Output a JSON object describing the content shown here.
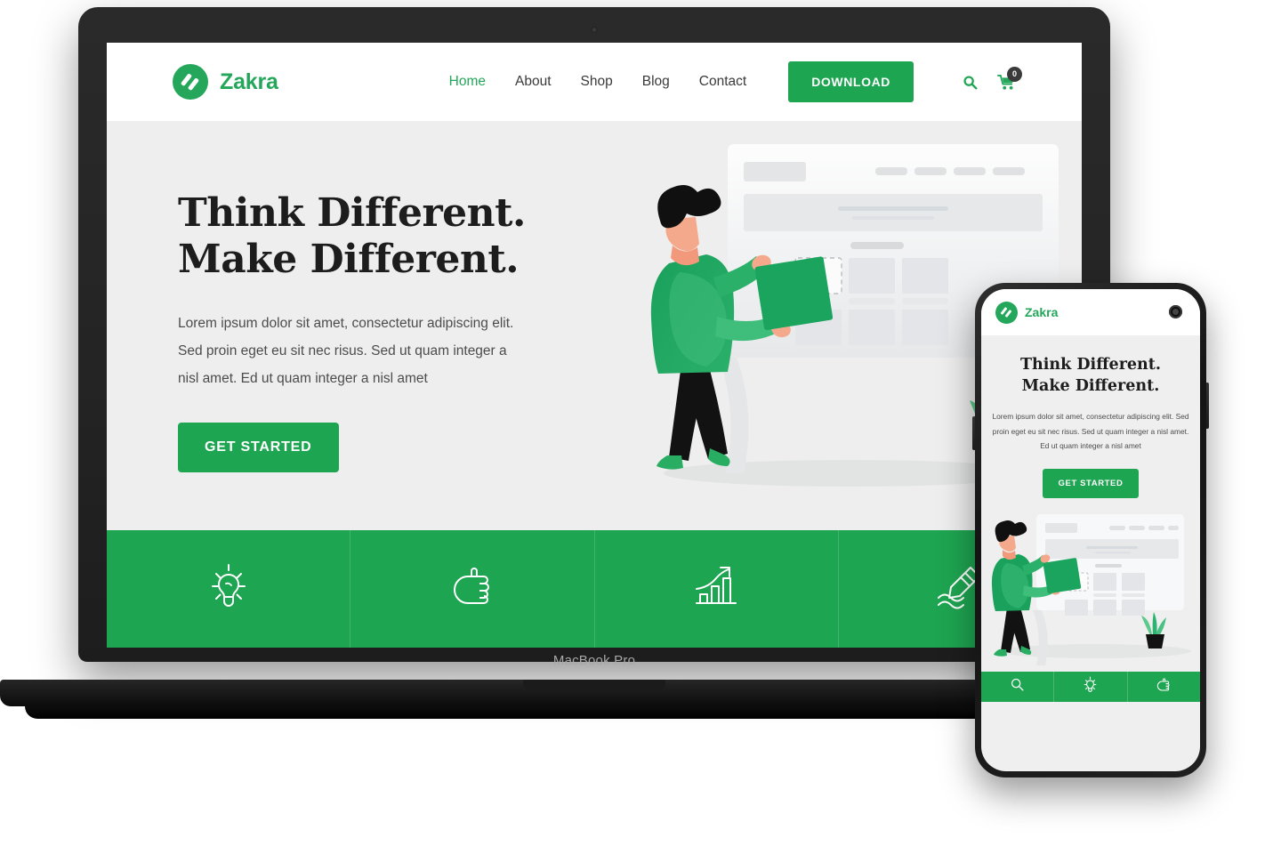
{
  "device": {
    "laptop_label": "MacBook Pro",
    "laptop_camera": "camera-dot",
    "phone_camera": "punch-hole-camera"
  },
  "brand": {
    "name": "Zakra",
    "logo_icon": "zakra-z-logo-icon",
    "accent_color": "#1ea551",
    "brand_green": "#24a75b"
  },
  "nav": {
    "links": [
      {
        "label": "Home",
        "active": true
      },
      {
        "label": "About",
        "active": false
      },
      {
        "label": "Shop",
        "active": false
      },
      {
        "label": "Blog",
        "active": false
      },
      {
        "label": "Contact",
        "active": false
      }
    ],
    "download_label": "DOWNLOAD",
    "search_icon": "search-icon",
    "cart_icon": "shopping-cart-icon",
    "cart_count": "0"
  },
  "hero": {
    "title_line1": "Think Different.",
    "title_line2": "Make Different.",
    "paragraph": "Lorem ipsum dolor sit amet, consectetur adipiscing elit. Sed proin eget eu sit nec risus. Sed ut quam integer a nisl amet.  Ed ut quam integer a nisl amet",
    "cta_label": "GET STARTED",
    "background_color": "#eeeeee",
    "illustration": "person-dragging-card-onto-wireframe-board"
  },
  "features": [
    {
      "icon": "lightbulb-icon"
    },
    {
      "icon": "thumbs-up-icon"
    },
    {
      "icon": "growth-chart-icon"
    },
    {
      "icon": "pen-marker-icon"
    }
  ],
  "phone": {
    "brand_name": "Zakra",
    "title_line1": "Think Different.",
    "title_line2": "Make Different.",
    "paragraph": "Lorem ipsum dolor sit amet, consectetur adipiscing elit. Sed proin eget eu sit nec risus. Sed ut quam integer a nisl amet.  Ed ut quam integer a nisl amet",
    "cta_label": "GET STARTED",
    "bottom_icons": [
      {
        "icon": "search-icon"
      },
      {
        "icon": "lightbulb-icon"
      },
      {
        "icon": "thumbs-up-icon"
      }
    ]
  }
}
